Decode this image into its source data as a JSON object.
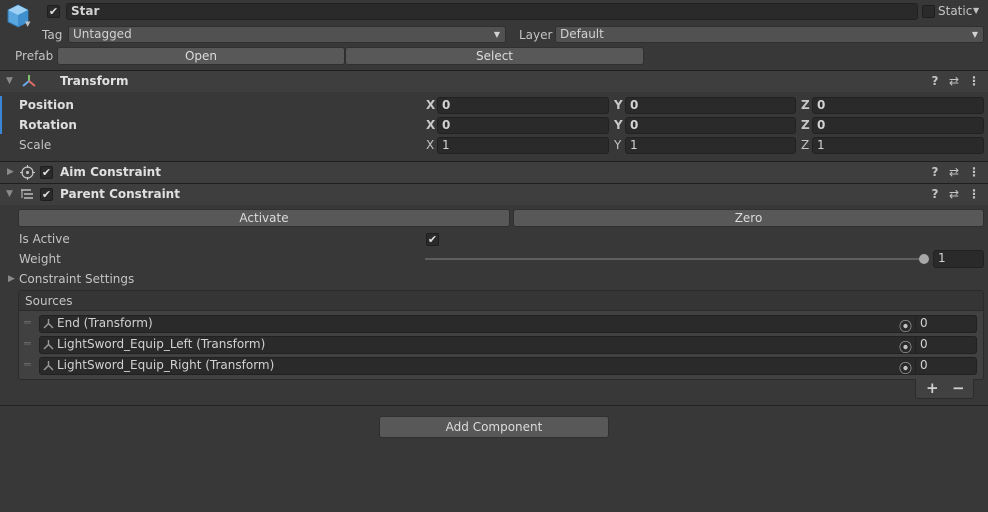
{
  "object": {
    "name": "Star",
    "static_label": "Static",
    "tag_label": "Tag",
    "tag_value": "Untagged",
    "layer_label": "Layer",
    "layer_value": "Default",
    "prefab_label": "Prefab",
    "open_label": "Open",
    "select_label": "Select"
  },
  "transform": {
    "title": "Transform",
    "rows": [
      {
        "label": "Position",
        "x": "0",
        "y": "0",
        "z": "0"
      },
      {
        "label": "Rotation",
        "x": "0",
        "y": "0",
        "z": "0"
      },
      {
        "label": "Scale",
        "x": "1",
        "y": "1",
        "z": "1"
      }
    ],
    "axis_x": "X",
    "axis_y": "Y",
    "axis_z": "Z"
  },
  "aim_constraint": {
    "title": "Aim Constraint"
  },
  "parent_constraint": {
    "title": "Parent Constraint",
    "activate_label": "Activate",
    "zero_label": "Zero",
    "is_active_label": "Is Active",
    "weight_label": "Weight",
    "weight_value": "1",
    "weight_fraction": 1,
    "constraint_settings_label": "Constraint Settings",
    "sources_label": "Sources",
    "sources": [
      {
        "name": "End (Transform)",
        "weight": "0"
      },
      {
        "name": "LightSword_Equip_Left (Transform)",
        "weight": "0"
      },
      {
        "name": "LightSword_Equip_Right (Transform)",
        "weight": "0"
      }
    ],
    "add_label": "+",
    "remove_label": "−"
  },
  "add_component_label": "Add Component",
  "icons": {
    "help": "?",
    "settings": "⇄",
    "menu": "⋮",
    "check": "✔",
    "expand": "▶",
    "collapse": "▼",
    "dropdown": "▼",
    "target": "⦿",
    "transform_axes": "⅄",
    "drag_handle": "═"
  },
  "colors": {
    "background": "#383838",
    "header": "#3e3e3e",
    "field": "#2a2a2a",
    "accent": "#3a85d4",
    "text": "#c4c4c4"
  }
}
